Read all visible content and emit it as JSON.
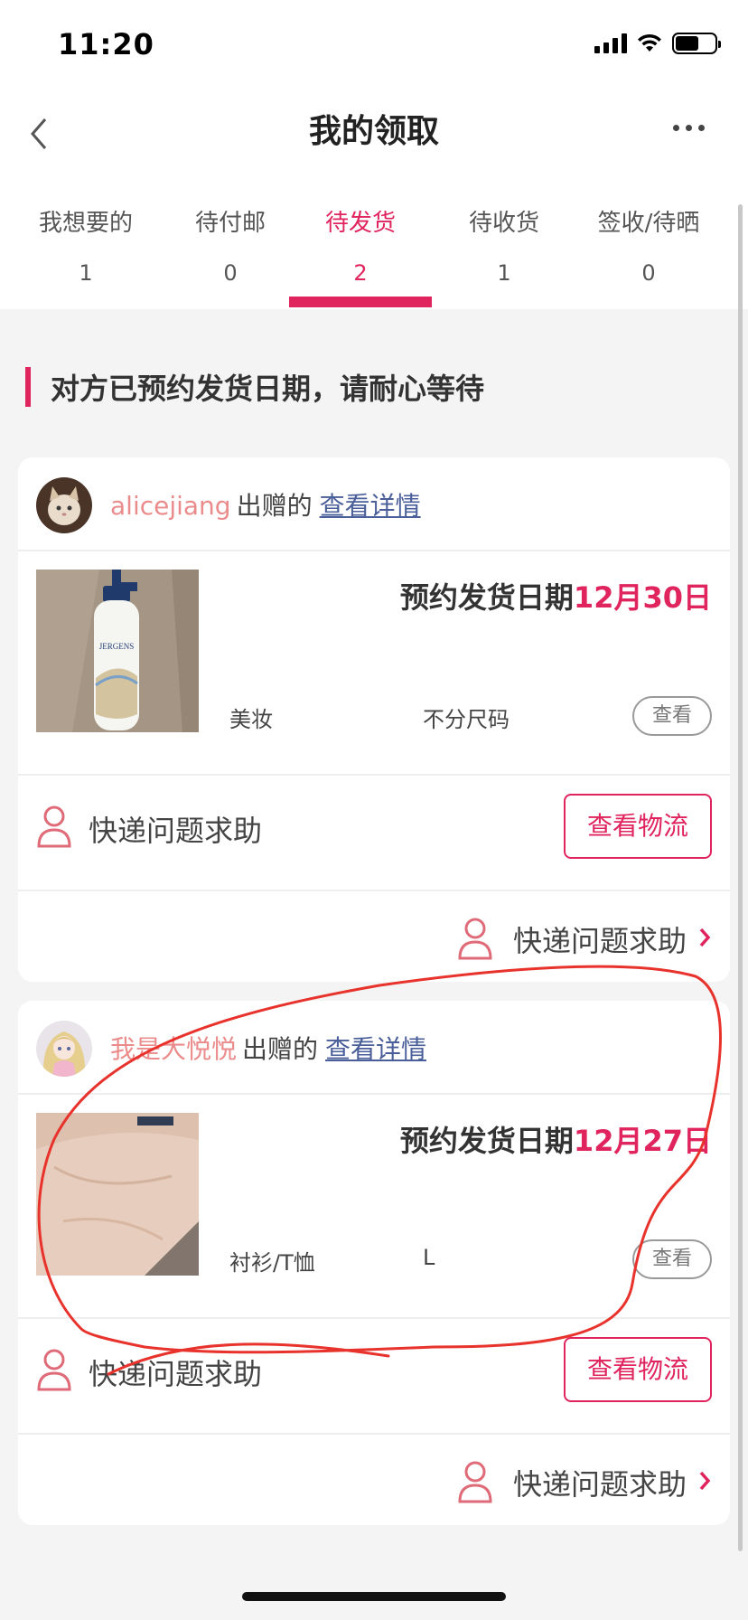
{
  "status_bar": {
    "time": "11:20"
  },
  "nav": {
    "title": "我的领取"
  },
  "tabs": [
    {
      "label": "我想要的",
      "count": "1"
    },
    {
      "label": "待付邮",
      "count": "0"
    },
    {
      "label": "待发货",
      "count": "2",
      "active": true
    },
    {
      "label": "待收货",
      "count": "1"
    },
    {
      "label": "签收/待晒",
      "count": "0"
    }
  ],
  "notice": "对方已预约发货日期，请耐心等待",
  "cards": [
    {
      "username": "alicejiang",
      "gift_word": "出赠的",
      "detail_link": "查看详情",
      "ship_label": "预约发货日期",
      "ship_date": "12月30日",
      "category": "美妆",
      "size": "不分尺码",
      "view_label": "查看",
      "help_label": "快递问题求助",
      "logistics_label": "查看物流",
      "footer_label": "快递问题求助"
    },
    {
      "username": "我是大悦悦",
      "gift_word": "出赠的",
      "detail_link": "查看详情",
      "ship_label": "预约发货日期",
      "ship_date": "12月27日",
      "category": "衬衫/T恤",
      "size": "L",
      "view_label": "查看",
      "help_label": "快递问题求助",
      "logistics_label": "查看物流",
      "footer_label": "快递问题求助"
    }
  ],
  "colors": {
    "accent": "#e0245e",
    "username": "#eb8c8c",
    "link": "#4a5f9a",
    "annotation": "#e8322c"
  }
}
